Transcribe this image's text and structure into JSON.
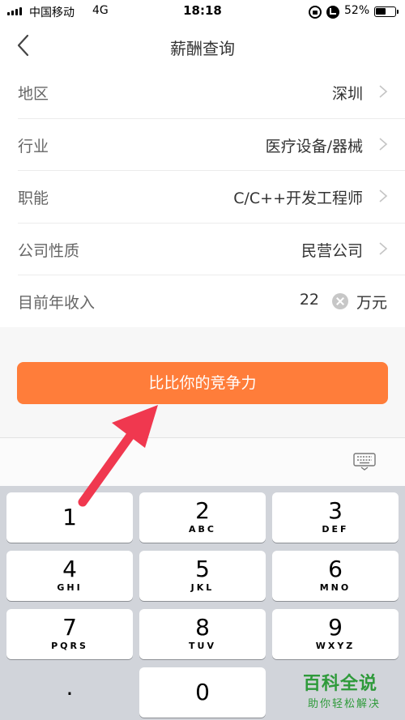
{
  "status_bar": {
    "carrier": "中国移动",
    "network": "4G",
    "time": "18:18",
    "battery_percent": "52%"
  },
  "header": {
    "title": "薪酬查询",
    "back_icon": "chevron-left-icon"
  },
  "form": {
    "rows": [
      {
        "label": "地区",
        "value": "深圳"
      },
      {
        "label": "行业",
        "value": "医疗设备/器械"
      },
      {
        "label": "职能",
        "value": "C/C++开发工程师"
      },
      {
        "label": "公司性质",
        "value": "民营公司"
      }
    ],
    "income": {
      "label": "目前年收入",
      "value": "22",
      "unit": "万元",
      "clear_icon": "clear-circle-icon"
    }
  },
  "action": {
    "submit_label": "比比你的竞争力",
    "button_color": "#ff7d3a"
  },
  "keyboard": {
    "keys": [
      {
        "digit": "1",
        "letters": ""
      },
      {
        "digit": "2",
        "letters": "ABC"
      },
      {
        "digit": "3",
        "letters": "DEF"
      },
      {
        "digit": "4",
        "letters": "GHI"
      },
      {
        "digit": "5",
        "letters": "JKL"
      },
      {
        "digit": "6",
        "letters": "MNO"
      },
      {
        "digit": "7",
        "letters": "PQRS"
      },
      {
        "digit": "8",
        "letters": "TUV"
      },
      {
        "digit": "9",
        "letters": "WXYZ"
      },
      {
        "digit": ".",
        "letters": ""
      },
      {
        "digit": "0",
        "letters": ""
      }
    ],
    "hide_icon": "keyboard-hide-icon"
  },
  "annotation": {
    "arrow_color": "#f0384f"
  },
  "watermark": {
    "title": "百科全说",
    "subtitle": "助你轻松解决"
  }
}
